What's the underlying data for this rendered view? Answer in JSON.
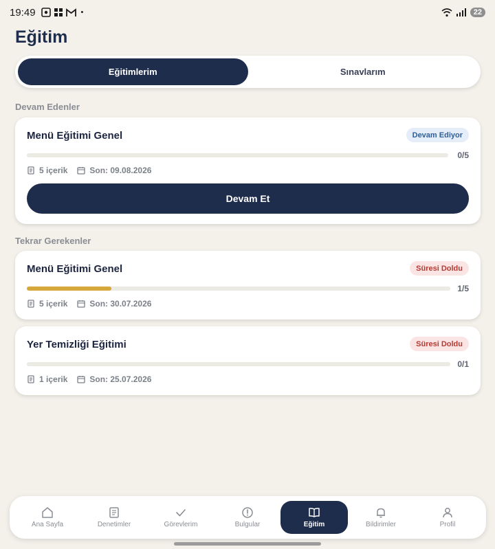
{
  "status_bar": {
    "time": "19:49",
    "dot": "•",
    "battery": "22"
  },
  "page_title": "Eğitim",
  "tabs": [
    {
      "label": "Eğitimlerim",
      "active": true
    },
    {
      "label": "Sınavlarım",
      "active": false
    }
  ],
  "sections": {
    "in_progress_label": "Devam Edenler",
    "retake_label": "Tekrar Gerekenler"
  },
  "in_progress_cards": [
    {
      "title": "Menü Eğitimi Genel",
      "badge": "Devam Ediyor",
      "progress_text": "0/5",
      "progress": 0.0,
      "content_count": "5 içerik",
      "deadline": "Son: 09.08.2026",
      "button_label": "Devam Et"
    }
  ],
  "retake_cards": [
    {
      "title": "Menü Eğitimi Genel",
      "badge": "Süresi Doldu",
      "progress_text": "1/5",
      "progress": 0.2,
      "content_count": "5 içerik",
      "deadline": "Son: 30.07.2026"
    },
    {
      "title": "Yer Temizliği Eğitimi",
      "badge": "Süresi Doldu",
      "progress_text": "0/1",
      "progress": 0.0,
      "content_count": "1 içerik",
      "deadline": "Son: 25.07.2026"
    }
  ],
  "bottom_nav": [
    {
      "label": "Ana Sayfa",
      "icon": "home-icon"
    },
    {
      "label": "Denetimler",
      "icon": "clipboard-icon"
    },
    {
      "label": "Görevlerim",
      "icon": "check-icon"
    },
    {
      "label": "Bulgular",
      "icon": "alert-circle-icon"
    },
    {
      "label": "Eğitim",
      "icon": "book-icon",
      "active": true
    },
    {
      "label": "Bildirimler",
      "icon": "bell-icon"
    },
    {
      "label": "Profil",
      "icon": "user-icon"
    }
  ],
  "colors": {
    "primary": "#1f2d4d",
    "background": "#f3f1ea",
    "progress_fill": "#d4a83b",
    "badge_blue_bg": "#e4edf8",
    "badge_red_bg": "#fbe5e4"
  }
}
